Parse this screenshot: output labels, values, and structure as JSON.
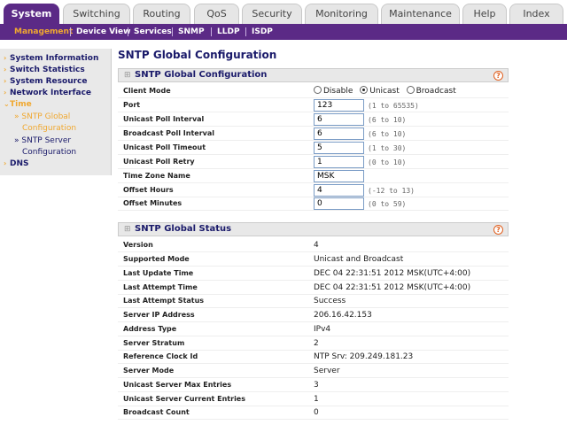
{
  "tabs": [
    {
      "label": "System",
      "active": true
    },
    {
      "label": "Switching"
    },
    {
      "label": "Routing"
    },
    {
      "label": "QoS"
    },
    {
      "label": "Security"
    },
    {
      "label": "Monitoring"
    },
    {
      "label": "Maintenance"
    },
    {
      "label": "Help"
    },
    {
      "label": "Index"
    }
  ],
  "subnav": [
    {
      "label": "Management",
      "active": true
    },
    {
      "label": "Device View"
    },
    {
      "label": "Services"
    },
    {
      "label": "SNMP"
    },
    {
      "label": "LLDP"
    },
    {
      "label": "ISDP"
    }
  ],
  "leftmenu": {
    "system_information": "System Information",
    "switch_statistics": "Switch Statistics",
    "system_resource": "System Resource",
    "network_interface": "Network Interface",
    "time": "Time",
    "sntp_global_1": "» SNTP Global",
    "sntp_global_2": "Configuration",
    "sntp_server_1": "» SNTP Server",
    "sntp_server_2": "Configuration",
    "dns": "DNS",
    "arrow_closed": "›",
    "arrow_open": "⌄"
  },
  "page_title": "SNTP Global Configuration",
  "config_panel": {
    "title": "SNTP Global Configuration",
    "client_mode": {
      "label": "Client Mode",
      "options": [
        "Disable",
        "Unicast",
        "Broadcast"
      ],
      "selected": "Unicast"
    },
    "fields": [
      {
        "label": "Port",
        "value": "123",
        "range": "(1 to 65535)"
      },
      {
        "label": "Unicast Poll Interval",
        "value": "6",
        "range": "(6 to 10)"
      },
      {
        "label": "Broadcast Poll Interval",
        "value": "6",
        "range": "(6 to 10)"
      },
      {
        "label": "Unicast Poll Timeout",
        "value": "5",
        "range": "(1 to 30)"
      },
      {
        "label": "Unicast Poll Retry",
        "value": "1",
        "range": "(0 to 10)"
      },
      {
        "label": "Time Zone Name",
        "value": "MSK",
        "range": ""
      },
      {
        "label": "Offset Hours",
        "value": "4",
        "range": "(-12 to 13)"
      },
      {
        "label": "Offset Minutes",
        "value": "0",
        "range": "(0 to 59)"
      }
    ]
  },
  "status_panel": {
    "title": "SNTP Global Status",
    "rows": [
      {
        "label": "Version",
        "value": "4"
      },
      {
        "label": "Supported Mode",
        "value": "Unicast and Broadcast"
      },
      {
        "label": "Last Update Time",
        "value": "DEC 04 22:31:51 2012 MSK(UTC+4:00)"
      },
      {
        "label": "Last Attempt Time",
        "value": "DEC 04 22:31:51 2012 MSK(UTC+4:00)"
      },
      {
        "label": "Last Attempt Status",
        "value": "Success"
      },
      {
        "label": "Server IP Address",
        "value": "206.16.42.153"
      },
      {
        "label": "Address Type",
        "value": "IPv4"
      },
      {
        "label": "Server Stratum",
        "value": "2"
      },
      {
        "label": "Reference Clock Id",
        "value": "NTP Srv: 209.249.181.23"
      },
      {
        "label": "Server Mode",
        "value": "Server"
      },
      {
        "label": "Unicast Server Max Entries",
        "value": "3"
      },
      {
        "label": "Unicast Server Current Entries",
        "value": "1"
      },
      {
        "label": "Broadcast Count",
        "value": "0"
      }
    ]
  },
  "help_glyph": "?",
  "plus_glyph": "⊞"
}
